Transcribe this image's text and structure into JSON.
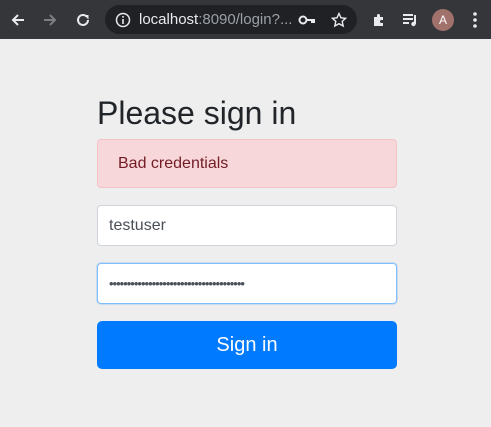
{
  "browser": {
    "url_host": "localhost",
    "url_rest": ":8090/login?...",
    "avatar_initial": "A",
    "icons": [
      "back-arrow-icon",
      "forward-arrow-icon",
      "reload-icon",
      "info-icon",
      "key-icon",
      "star-icon",
      "extensions-puzzle-icon",
      "media-queue-icon",
      "kebab-menu-icon"
    ]
  },
  "login": {
    "heading": "Please sign in",
    "error_message": "Bad credentials",
    "username_value": "testuser",
    "password_value": "••••••••••••••••••••••••••••••••••••••",
    "submit_label": "Sign in"
  },
  "colors": {
    "toolbar_bg": "#35363a",
    "page_bg": "#eeeeee",
    "alert_bg": "#f8d7da",
    "alert_text": "#721c24",
    "primary": "#007bff"
  }
}
